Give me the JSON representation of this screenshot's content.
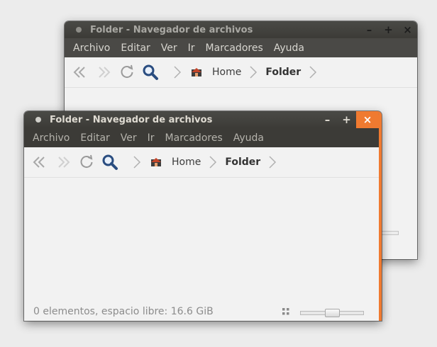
{
  "windows": {
    "back": {
      "title": "Folder - Navegador de archivos",
      "menu": [
        "Archivo",
        "Editar",
        "Ver",
        "Ir",
        "Marcadores",
        "Ayuda"
      ],
      "breadcrumb": {
        "home": "Home",
        "current": "Folder"
      },
      "controls": {
        "minimize": "–",
        "maximize": "+",
        "close": "×"
      }
    },
    "front": {
      "title": "Folder - Navegador de archivos",
      "menu": [
        "Archivo",
        "Editar",
        "Ver",
        "Ir",
        "Marcadores",
        "Ayuda"
      ],
      "breadcrumb": {
        "home": "Home",
        "current": "Folder"
      },
      "controls": {
        "minimize": "–",
        "maximize": "+",
        "close": "×"
      },
      "status": "0 elementos, espacio libre: 16.6 GiB",
      "zoom_level": 0.5
    }
  },
  "icons": {
    "back": "back-arrow-icon",
    "forward": "forward-arrow-icon",
    "reload": "reload-icon",
    "search": "search-icon",
    "home": "home-folder-icon",
    "separator": "chevron-right-icon"
  },
  "colors": {
    "accent": "#f07a30",
    "titlebar": "#3c3b37"
  }
}
